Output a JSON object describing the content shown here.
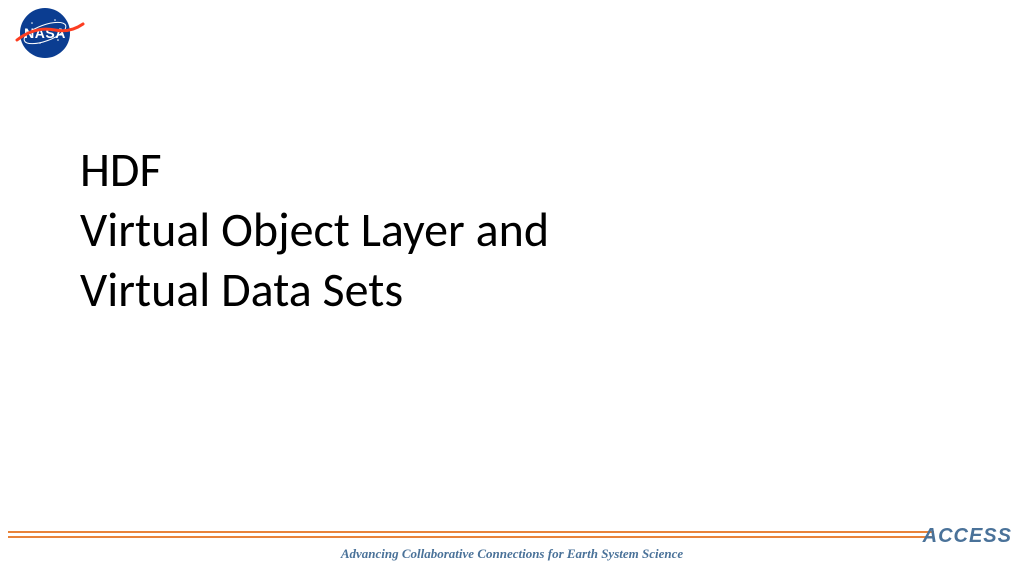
{
  "logo": {
    "nasa_text": "NASA"
  },
  "title": {
    "line1": "HDF",
    "line2": "Virtual Object Layer and",
    "line3": "Virtual Data Sets"
  },
  "footer": {
    "tagline": "Advancing Collaborative Connections for Earth System Science",
    "access_logo": "ACCESS"
  }
}
